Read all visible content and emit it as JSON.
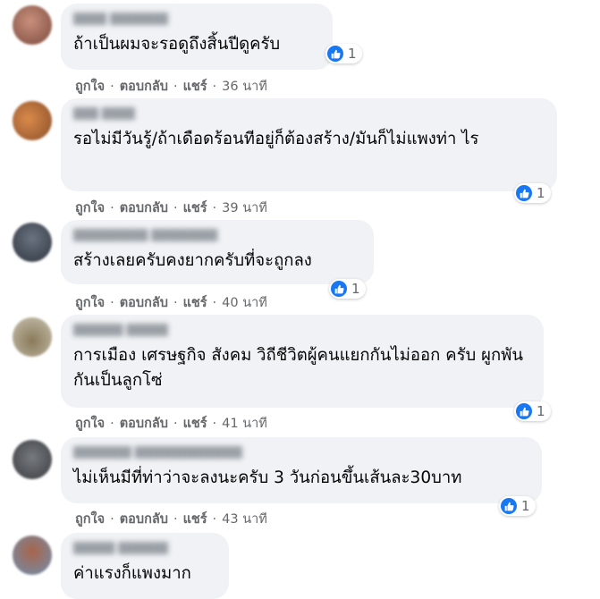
{
  "colors": {
    "bubble_bg": "#f0f2f5",
    "like_blue": "#1877f2",
    "meta_gray": "#65676b"
  },
  "actions": {
    "like": "ถูกใจ",
    "reply": "ตอบกลับ",
    "share": "แชร์",
    "separator": "·"
  },
  "comments": [
    {
      "text": "ถ้าเป็นผมจะรอดูถึงสิ้นปีดูครับ",
      "reaction_icon": "like-icon",
      "reaction_count": "1",
      "time": "36 นาที"
    },
    {
      "text": "รอไม่มีวันรู้/ถ้าเดือดร้อนทีอยู่ก็ต้องสร้าง/มันก็ไม่แพงท่า ไร",
      "reaction_icon": "like-icon",
      "reaction_count": "1",
      "time": "39 นาที"
    },
    {
      "text": "สร้างเลยครับคงยากครับที่จะถูกลง",
      "reaction_icon": "like-icon",
      "reaction_count": "1",
      "time": "40 นาที"
    },
    {
      "text": "การเมือง เศรษฐกิจ สังคม วิถีชีวิตผู้คนแยกกันไม่ออก ครับ ผูกพันกันเป็นลูกโซ่",
      "reaction_icon": "like-icon",
      "reaction_count": "1",
      "time": "41 นาที"
    },
    {
      "text": "ไม่เห็นมีที่ท่าว่าจะลงนะครับ 3 วันก่อนขึ้นเส้นละ30บาท",
      "reaction_icon": "like-icon",
      "reaction_count": "1",
      "time": "43 นาที"
    },
    {
      "text": "ค่าแรงก็แพงมาก"
    }
  ]
}
